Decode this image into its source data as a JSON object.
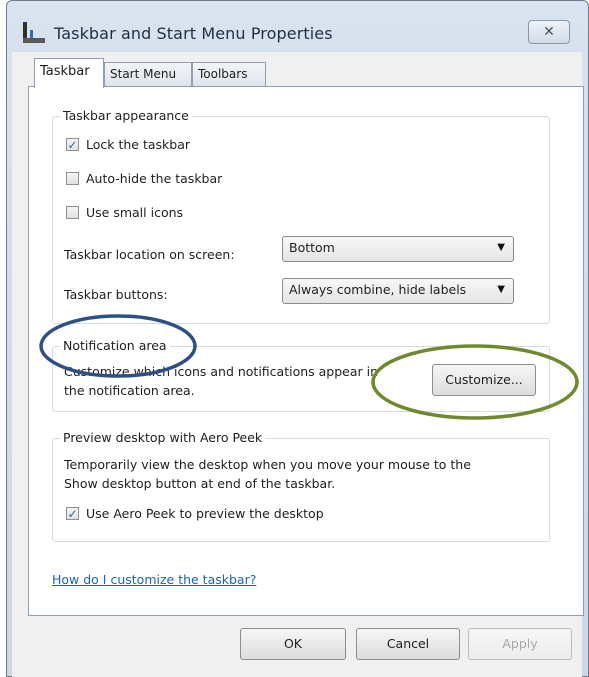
{
  "window": {
    "title": "Taskbar and Start Menu Properties",
    "close_glyph": "✕"
  },
  "tabs": [
    {
      "label": "Taskbar",
      "active": true
    },
    {
      "label": "Start Menu",
      "active": false
    },
    {
      "label": "Toolbars",
      "active": false
    }
  ],
  "appearance": {
    "group_title": "Taskbar appearance",
    "lock_label": "Lock the taskbar",
    "lock_checked": true,
    "autohide_label": "Auto-hide the taskbar",
    "autohide_checked": false,
    "small_icons_label": "Use small icons",
    "small_icons_checked": false,
    "location_label": "Taskbar location on screen:",
    "location_value": "Bottom",
    "buttons_label": "Taskbar buttons:",
    "buttons_value": "Always combine, hide labels"
  },
  "notification": {
    "group_title": "Notification area",
    "description_line1": "Customize which icons and notifications appear in",
    "description_line2": "the notification area.",
    "customize_label": "Customize..."
  },
  "aero_peek": {
    "group_title": "Preview desktop with Aero Peek",
    "description_line1": "Temporarily view the desktop when you move your mouse to the",
    "description_line2": "Show desktop button at end of the taskbar.",
    "checkbox_label": "Use Aero Peek to preview the desktop",
    "checked": true
  },
  "help_link": "How do I customize the taskbar?",
  "footer": {
    "ok_label": "OK",
    "cancel_label": "Cancel",
    "apply_label": "Apply"
  },
  "annotations": {
    "blue_oval_color": "#2e4f84",
    "green_oval_color": "#6f8a2e"
  },
  "icons": {
    "check": "✓",
    "dropdown": "▼"
  }
}
